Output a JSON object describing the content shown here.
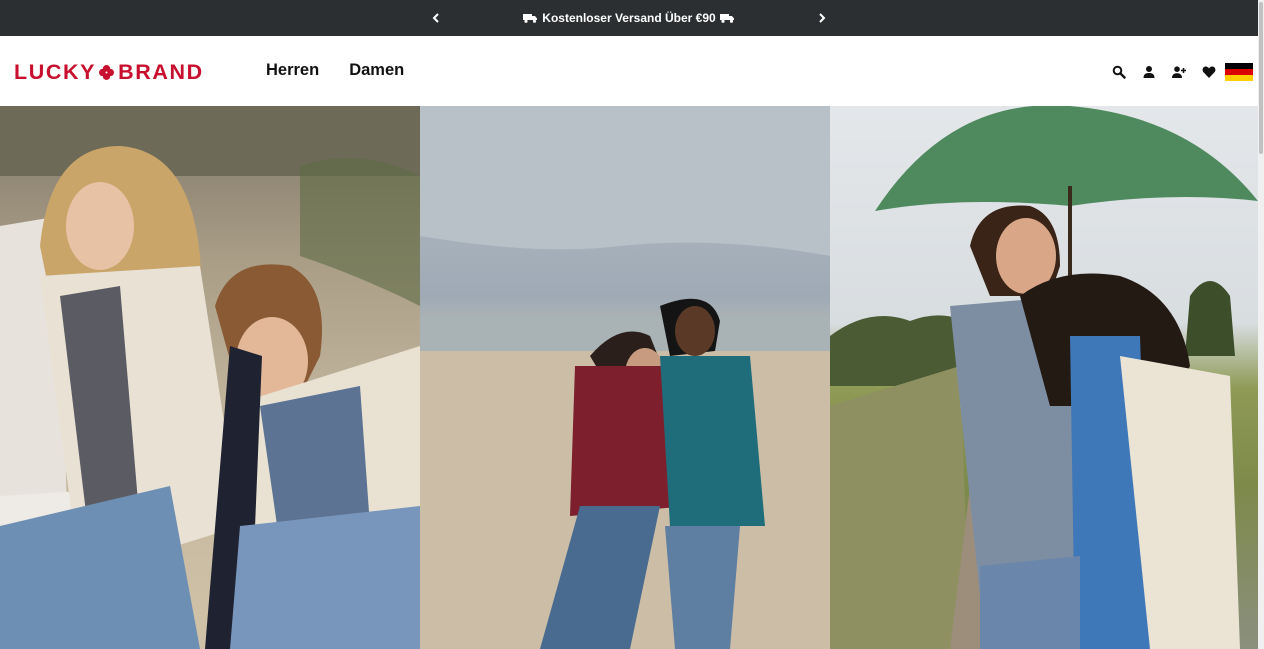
{
  "promo": {
    "message": "Kostenloser Versand Über €90"
  },
  "brand": {
    "word1": "LUCKY",
    "word2": "BRAND"
  },
  "nav": [
    {
      "label": "Herren"
    },
    {
      "label": "Damen"
    }
  ],
  "utils": {
    "icons": [
      "search-icon",
      "account-icon",
      "add-user-icon",
      "wishlist-heart-icon",
      "germany-flag-icon"
    ]
  },
  "colors": {
    "brand_red": "#c8102e",
    "promo_bg": "#2b2f31"
  },
  "hero": {
    "panels": [
      {
        "name": "hero-image-couple-beach-dunes"
      },
      {
        "name": "hero-image-couple-beach-puffer-jackets"
      },
      {
        "name": "hero-image-couple-umbrella-boardwalk"
      }
    ]
  }
}
